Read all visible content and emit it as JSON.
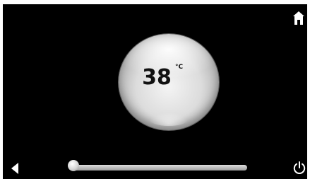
{
  "theme": {
    "background": "#000000",
    "foreground": "#ffffff",
    "dial_face": "#e6e6e6",
    "digit_color": "#111111"
  },
  "header": {
    "home_icon": "home-icon"
  },
  "dial": {
    "temperature": "38",
    "unit": "°C"
  },
  "footer": {
    "back_icon": "back-arrow-icon",
    "power_icon": "power-icon",
    "slider": {
      "level": 0.0
    }
  }
}
